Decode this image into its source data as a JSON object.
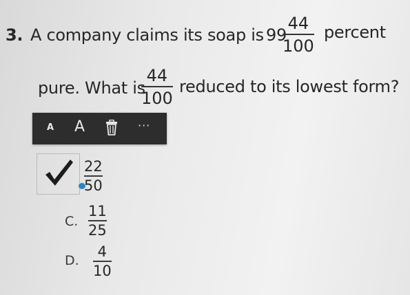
{
  "question": {
    "number": "3.",
    "line1_text": "A company claims its soap is",
    "mixed_whole": "99",
    "mixed_num": "44",
    "mixed_den": "100",
    "line1_end": "percent",
    "line2_text": "pure. What is",
    "frac_num": "44",
    "frac_den": "100",
    "line2_end": "reduced to its lowest form?"
  },
  "toolbar": {
    "small_a": "A",
    "large_a": "A",
    "more": "···"
  },
  "options": {
    "a": {
      "num": "22",
      "den": "50",
      "checked": true
    },
    "c": {
      "letter": "C.",
      "num": "11",
      "den": "25"
    },
    "d": {
      "letter": "D.",
      "num": "4",
      "den": "10"
    }
  },
  "colors": {
    "toolbar_bg": "#2d2d2d",
    "check": "#1a1a1a",
    "radio_dot": "#2a86c6"
  }
}
